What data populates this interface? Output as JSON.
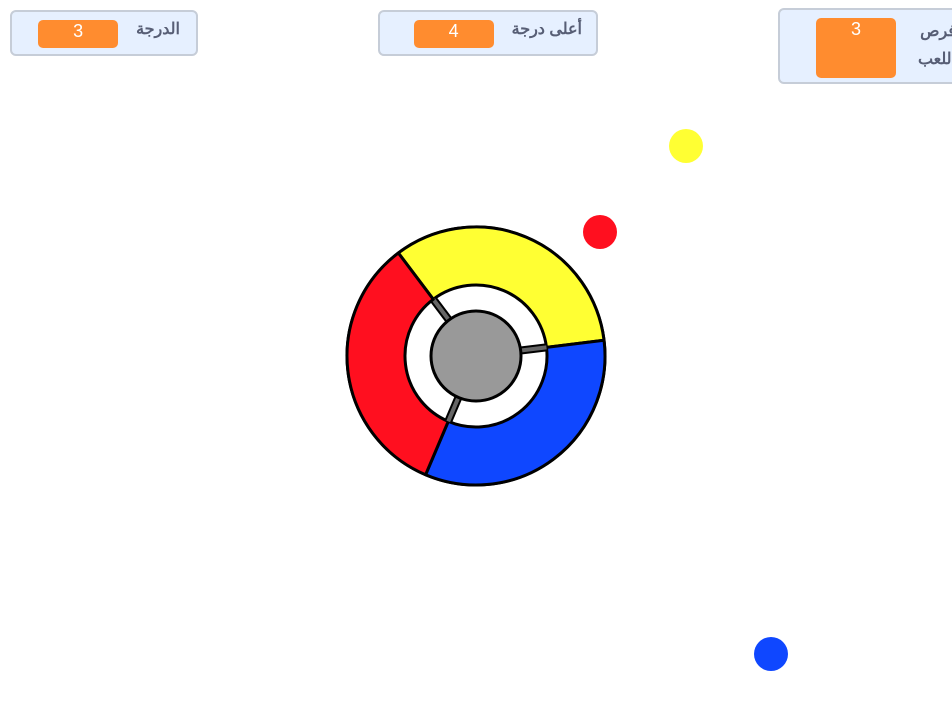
{
  "monitors": {
    "score": {
      "label": "الدرجة",
      "value": "3"
    },
    "high_score": {
      "label": "أعلى درجة",
      "value": "4"
    },
    "lives": {
      "label": "فرص اللعب",
      "value": "3"
    }
  },
  "colors": {
    "yellow": "#ffff33",
    "red": "#ff0f1f",
    "blue": "#0f47ff",
    "hub": "#999999",
    "monitor_value": "#ff8c2f"
  },
  "wheel": {
    "segments": [
      "yellow",
      "blue",
      "red"
    ]
  },
  "balls": [
    "yellow",
    "red",
    "blue"
  ]
}
